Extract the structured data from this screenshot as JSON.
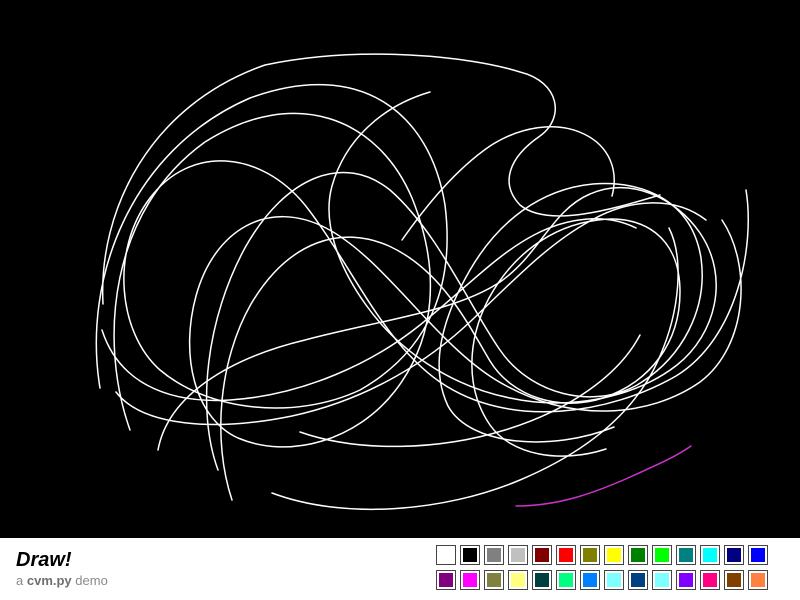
{
  "app": {
    "title": "Draw!",
    "subtitle_prefix": "a",
    "subtitle_brand": "cvm.py",
    "subtitle_suffix": "demo"
  },
  "canvas": {
    "background": "#000000",
    "stroke_colors": {
      "main": "#ffffff",
      "accent": "#cc33cc"
    }
  },
  "palette": {
    "colors": [
      "#ffffff",
      "#000000",
      "#808080",
      "#c0c0c0",
      "#800000",
      "#ff0000",
      "#808000",
      "#ffff00",
      "#008000",
      "#00ff00",
      "#008080",
      "#00ffff",
      "#000080",
      "#0000ff",
      "#800080",
      "#ff00ff",
      "#808040",
      "#ffff80",
      "#004040",
      "#00ff80",
      "#0080ff",
      "#80ffff",
      "#004080",
      "#80ffff",
      "#8000ff",
      "#ff0080",
      "#804000",
      "#ff8040"
    ]
  }
}
